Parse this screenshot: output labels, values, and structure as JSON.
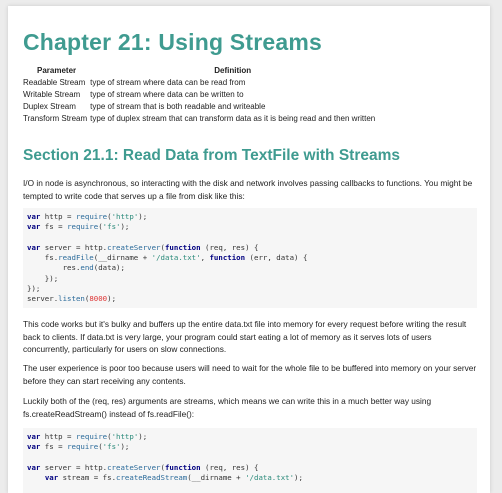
{
  "chapter_title": "Chapter 21: Using Streams",
  "table": {
    "headers": [
      "Parameter",
      "Definition"
    ],
    "rows": [
      {
        "param": "Readable Stream",
        "def": "type of stream where data can be read from"
      },
      {
        "param": "Writable Stream",
        "def": "type of stream where data can be written to"
      },
      {
        "param": "Duplex Stream",
        "def": "type of stream that is both readable and writeable"
      },
      {
        "param": "Transform Stream",
        "def": "type of duplex stream that can transform data as it is being read and then written"
      }
    ]
  },
  "section_title": "Section 21.1: Read Data from TextFile with Streams",
  "paragraphs": [
    "I/O in node is asynchronous, so interacting with the disk and network involves passing callbacks to functions. You might be tempted to write code that serves up a file from disk like this:",
    "This code works but it's bulky and buffers up the entire data.txt file into memory for every request before writing the result back to clients. If data.txt is very large, your program could start eating a lot of memory as it serves lots of users concurrently, particularly for users on slow connections.",
    "The user experience is poor too because users will need to wait for the whole file to be buffered into memory on your server before they can start receiving any contents.",
    "Luckily both of the (req, res) arguments are streams, which means we can write this in a much better way using fs.createReadStream() instead of fs.readFile():"
  ],
  "code1": {
    "l1": {
      "kw": "var",
      "a": " http = ",
      "fn": "require",
      "b": "(",
      "str": "'http'",
      "c": ");"
    },
    "l2": {
      "kw": "var",
      "a": " fs = ",
      "fn": "require",
      "b": "(",
      "str": "'fs'",
      "c": ");"
    },
    "l3": {
      "kw": "var",
      "a": " server = http.",
      "fn": "createServer",
      "b": "(",
      "kw2": "function",
      "c": " (req, res) {"
    },
    "l4": {
      "a": "    fs.",
      "fn": "readFile",
      "b": "(__dirname + ",
      "str": "'/data.txt'",
      "c": ", ",
      "kw": "function",
      "d": " (err, data) {"
    },
    "l5": {
      "a": "        res.",
      "fn": "end",
      "b": "(data);"
    },
    "l6": "    });",
    "l7": "});",
    "l8": {
      "a": "server.",
      "fn": "listen",
      "b": "(",
      "num": "8000",
      "c": ");"
    }
  },
  "code2": {
    "l1": {
      "kw": "var",
      "a": " http = ",
      "fn": "require",
      "b": "(",
      "str": "'http'",
      "c": ");"
    },
    "l2": {
      "kw": "var",
      "a": " fs = ",
      "fn": "require",
      "b": "(",
      "str": "'fs'",
      "c": ");"
    },
    "l3": {
      "kw": "var",
      "a": " server = http.",
      "fn": "createServer",
      "b": "(",
      "kw2": "function",
      "c": " (req, res) {"
    },
    "l4": {
      "a": "    ",
      "kw": "var",
      "b": " stream = fs.",
      "fn": "createReadStream",
      "c": "(__dirname + ",
      "str": "'/data.txt'",
      "d": ");"
    }
  }
}
